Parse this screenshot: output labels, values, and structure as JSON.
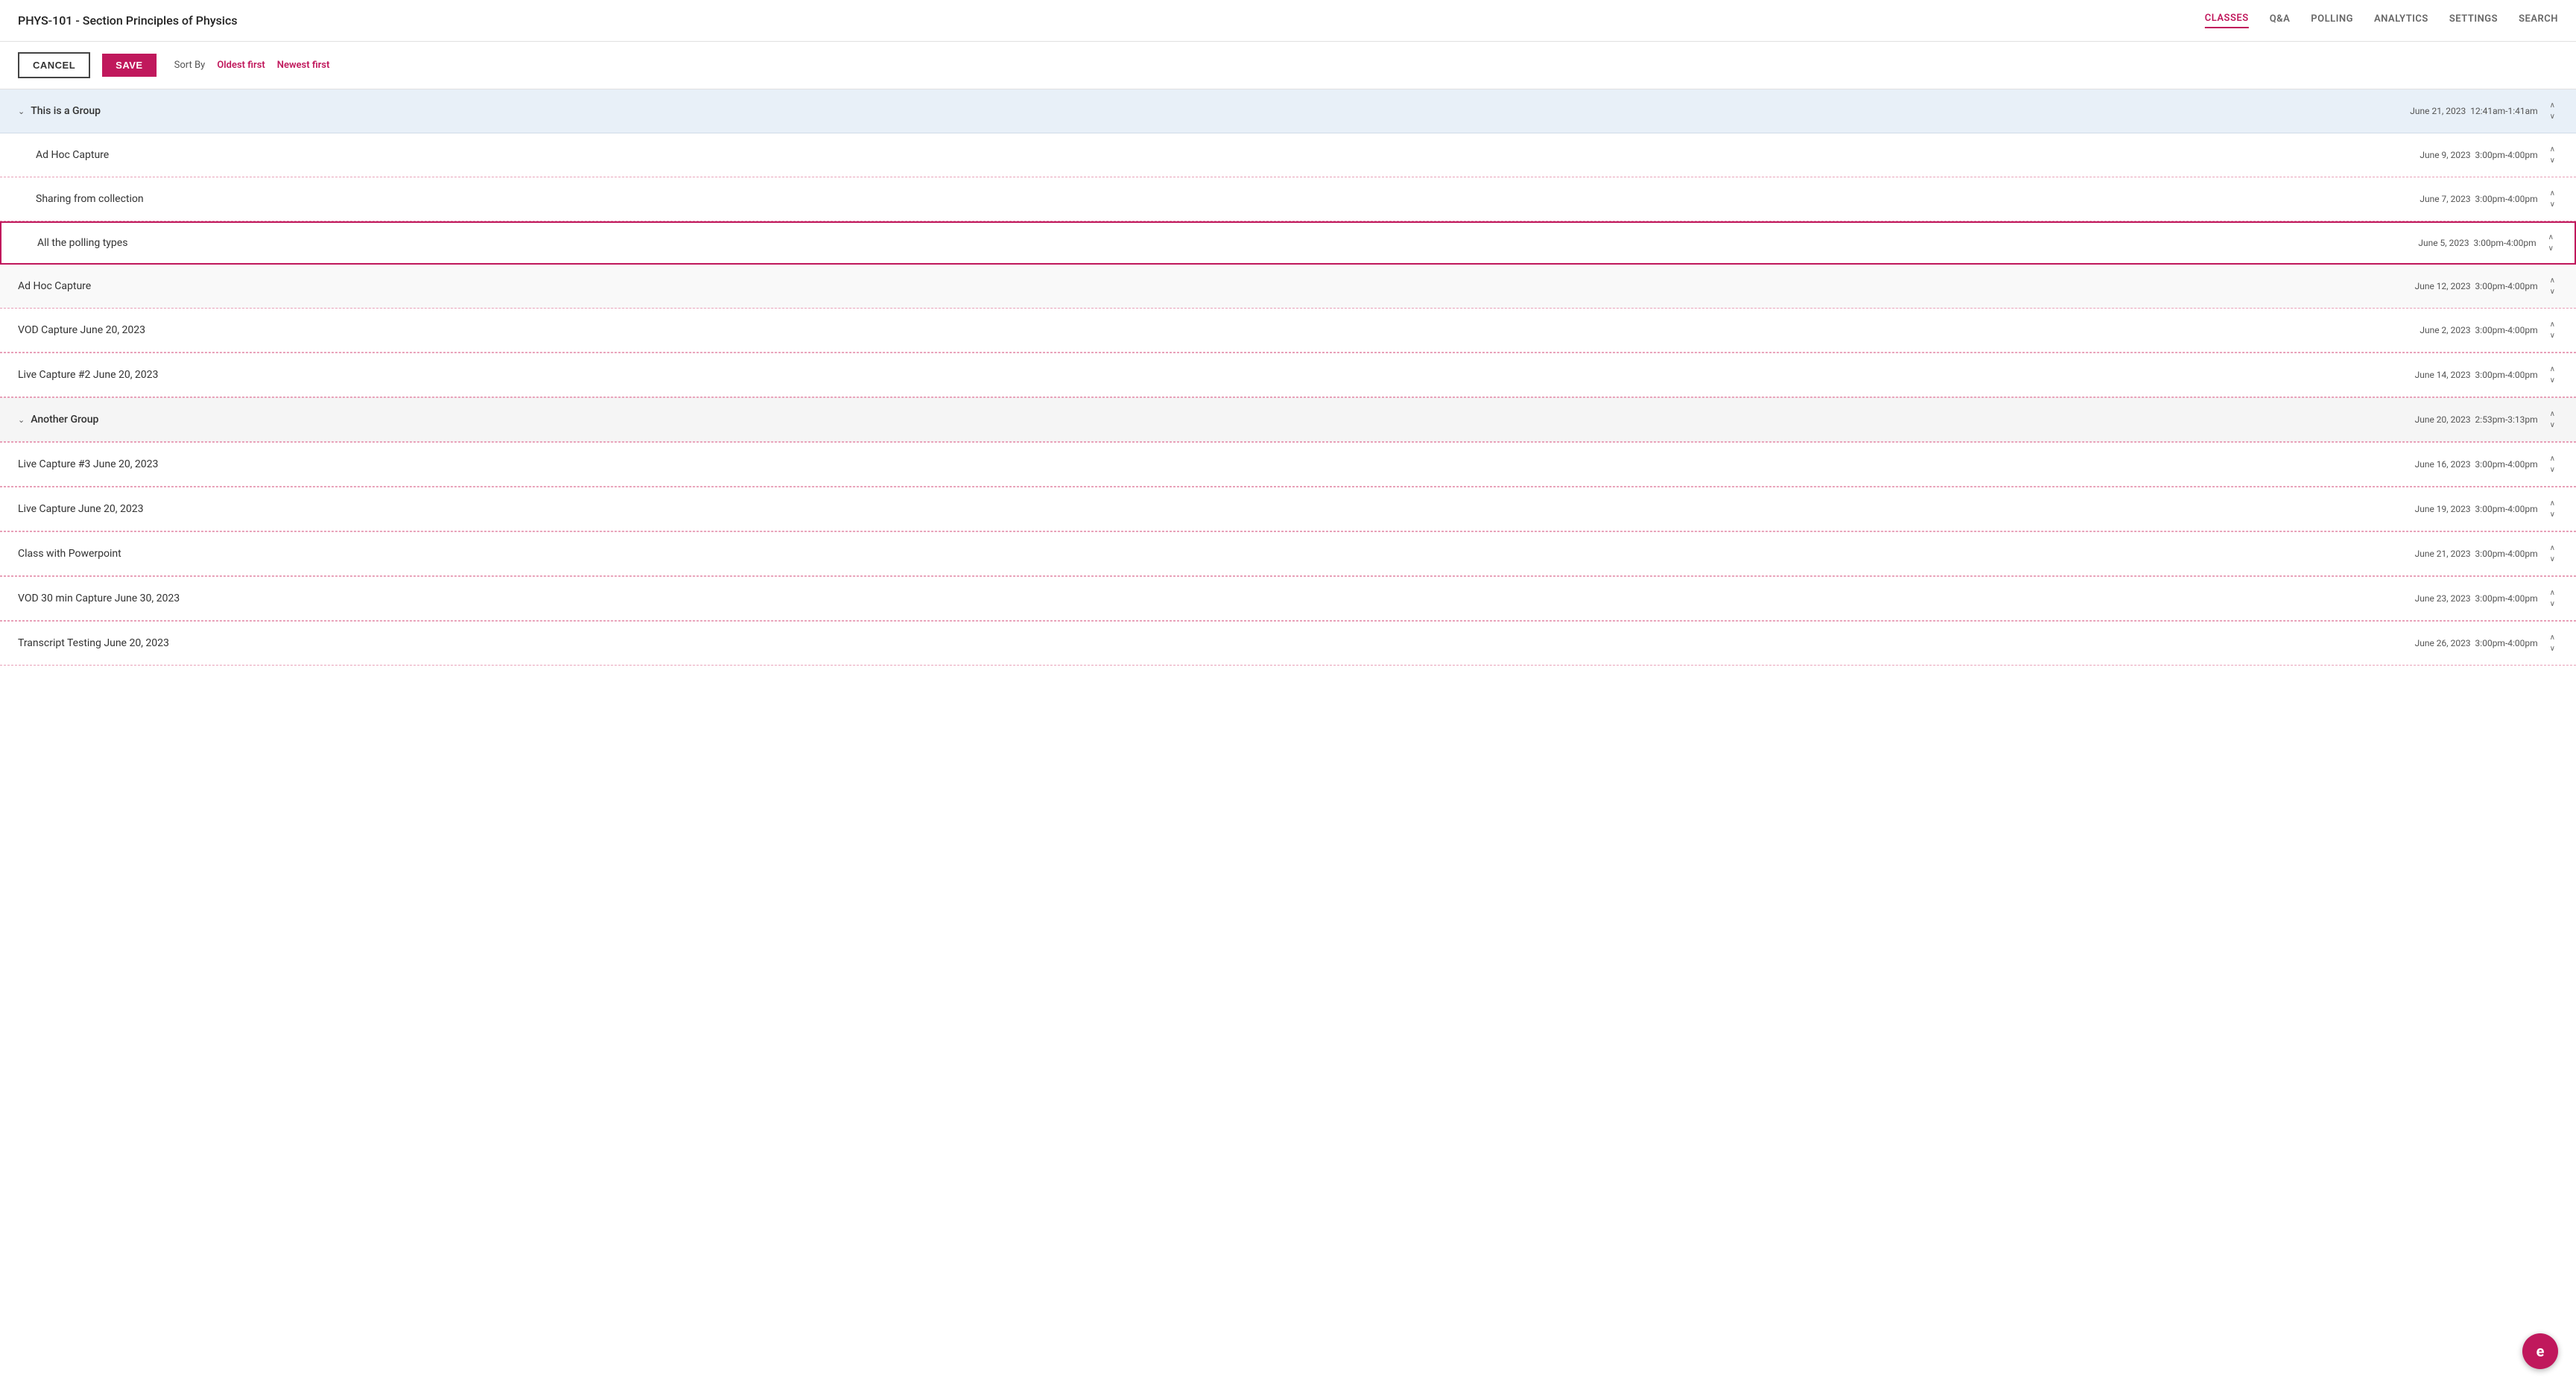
{
  "header": {
    "title": "PHYS-101 - Section Principles of Physics",
    "nav_tabs": [
      {
        "label": "CLASSES",
        "active": true
      },
      {
        "label": "Q&A",
        "active": false
      },
      {
        "label": "POLLING",
        "active": false
      },
      {
        "label": "ANALYTICS",
        "active": false
      },
      {
        "label": "SETTINGS",
        "active": false
      },
      {
        "label": "SEARCH",
        "active": false
      }
    ]
  },
  "toolbar": {
    "cancel_label": "CANCEL",
    "save_label": "SAVE",
    "sort_by_label": "Sort By",
    "oldest_first_label": "Oldest first",
    "newest_first_label": "Newest first"
  },
  "classes": [
    {
      "type": "group",
      "name": "This is a Group",
      "date": "June 21, 2023",
      "time": "12:41am-1:41am",
      "children": [
        {
          "type": "class",
          "name": "Ad Hoc Capture",
          "date": "June 9, 2023",
          "time": "3:00pm-4:00pm",
          "highlighted": false
        },
        {
          "type": "class",
          "name": "Sharing from collection",
          "date": "June 7, 2023",
          "time": "3:00pm-4:00pm",
          "highlighted": false
        },
        {
          "type": "class",
          "name": "All the polling types",
          "date": "June 5, 2023",
          "time": "3:00pm-4:00pm",
          "highlighted": true
        }
      ]
    },
    {
      "type": "class",
      "name": "Ad Hoc Capture",
      "date": "June 12, 2023",
      "time": "3:00pm-4:00pm",
      "highlighted": false,
      "top_level": true
    },
    {
      "type": "class",
      "name": "VOD Capture June 20, 2023",
      "date": "June 2, 2023",
      "time": "3:00pm-4:00pm",
      "highlighted": false,
      "top_level": true
    },
    {
      "type": "class",
      "name": "Live Capture #2 June 20, 2023",
      "date": "June 14, 2023",
      "time": "3:00pm-4:00pm",
      "highlighted": false,
      "top_level": true
    },
    {
      "type": "group",
      "name": "Another Group",
      "date": "June 20, 2023",
      "time": "2:53pm-3:13pm",
      "children": []
    },
    {
      "type": "class",
      "name": "Live Capture #3 June 20, 2023",
      "date": "June 16, 2023",
      "time": "3:00pm-4:00pm",
      "highlighted": false,
      "top_level": true
    },
    {
      "type": "class",
      "name": "Live Capture June 20, 2023",
      "date": "June 19, 2023",
      "time": "3:00pm-4:00pm",
      "highlighted": false,
      "top_level": true
    },
    {
      "type": "class",
      "name": "Class with Powerpoint",
      "date": "June 21, 2023",
      "time": "3:00pm-4:00pm",
      "highlighted": false,
      "top_level": true
    },
    {
      "type": "class",
      "name": "VOD 30 min Capture June 30, 2023",
      "date": "June 23, 2023",
      "time": "3:00pm-4:00pm",
      "highlighted": false,
      "top_level": true
    },
    {
      "type": "class",
      "name": "Transcript Testing June 20, 2023",
      "date": "June 26, 2023",
      "time": "3:00pm-4:00pm",
      "highlighted": false,
      "top_level": true
    }
  ],
  "fab": {
    "label": "e"
  }
}
